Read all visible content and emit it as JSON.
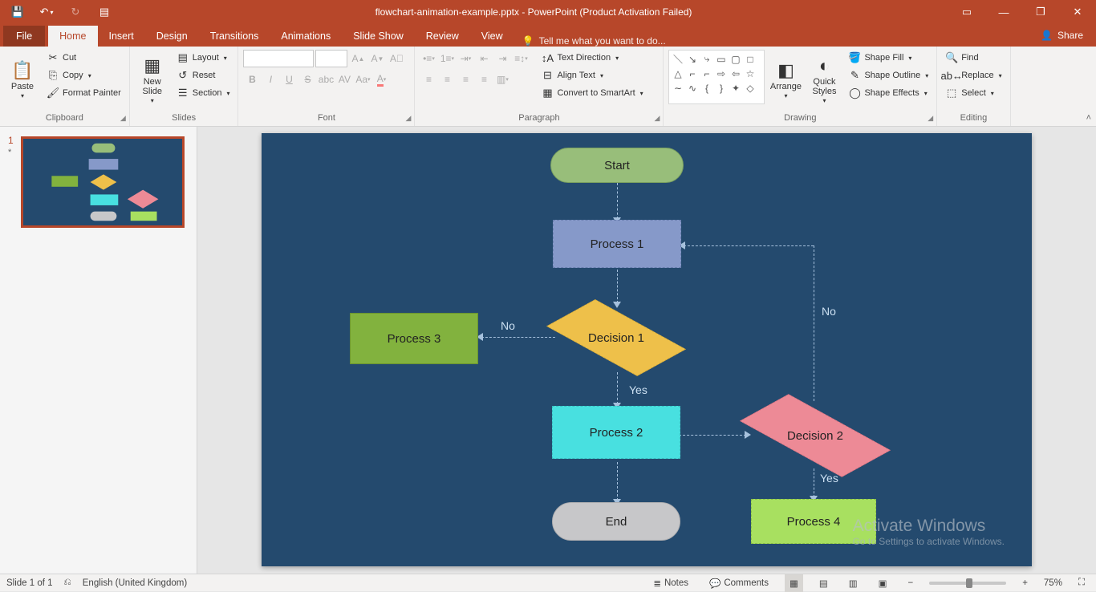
{
  "titlebar": {
    "filename": "flowchart-animation-example.pptx - PowerPoint (Product Activation Failed)"
  },
  "tabs": {
    "file": "File",
    "home": "Home",
    "insert": "Insert",
    "design": "Design",
    "transitions": "Transitions",
    "animations": "Animations",
    "slideshow": "Slide Show",
    "review": "Review",
    "view": "View",
    "tellme": "Tell me what you want to do...",
    "share": "Share"
  },
  "ribbon": {
    "paste": "Paste",
    "cut": "Cut",
    "copy": "Copy",
    "format_painter": "Format Painter",
    "clipboard": "Clipboard",
    "new_slide": "New Slide",
    "layout": "Layout",
    "reset": "Reset",
    "section": "Section",
    "slides": "Slides",
    "font": "Font",
    "paragraph": "Paragraph",
    "text_direction": "Text Direction",
    "align_text": "Align Text",
    "convert_smartart": "Convert to SmartArt",
    "arrange": "Arrange",
    "quick_styles": "Quick Styles",
    "shape_fill": "Shape Fill",
    "shape_outline": "Shape Outline",
    "shape_effects": "Shape Effects",
    "drawing": "Drawing",
    "find": "Find",
    "replace": "Replace",
    "select": "Select",
    "editing": "Editing"
  },
  "slide_panel": {
    "number": "1",
    "anim": "*"
  },
  "flowchart": {
    "start": "Start",
    "process1": "Process 1",
    "decision1": "Decision 1",
    "process2": "Process 2",
    "process3": "Process 3",
    "decision2": "Decision 2",
    "process4": "Process 4",
    "end": "End",
    "yes1": "Yes",
    "no1": "No",
    "yes2": "Yes",
    "no2": "No"
  },
  "statusbar": {
    "slide_info": "Slide 1 of 1",
    "language": "English (United Kingdom)",
    "notes": "Notes",
    "comments": "Comments",
    "zoom": "75%"
  },
  "watermark": {
    "line1": "Activate Windows",
    "line2": "Go to Settings to activate Windows."
  }
}
